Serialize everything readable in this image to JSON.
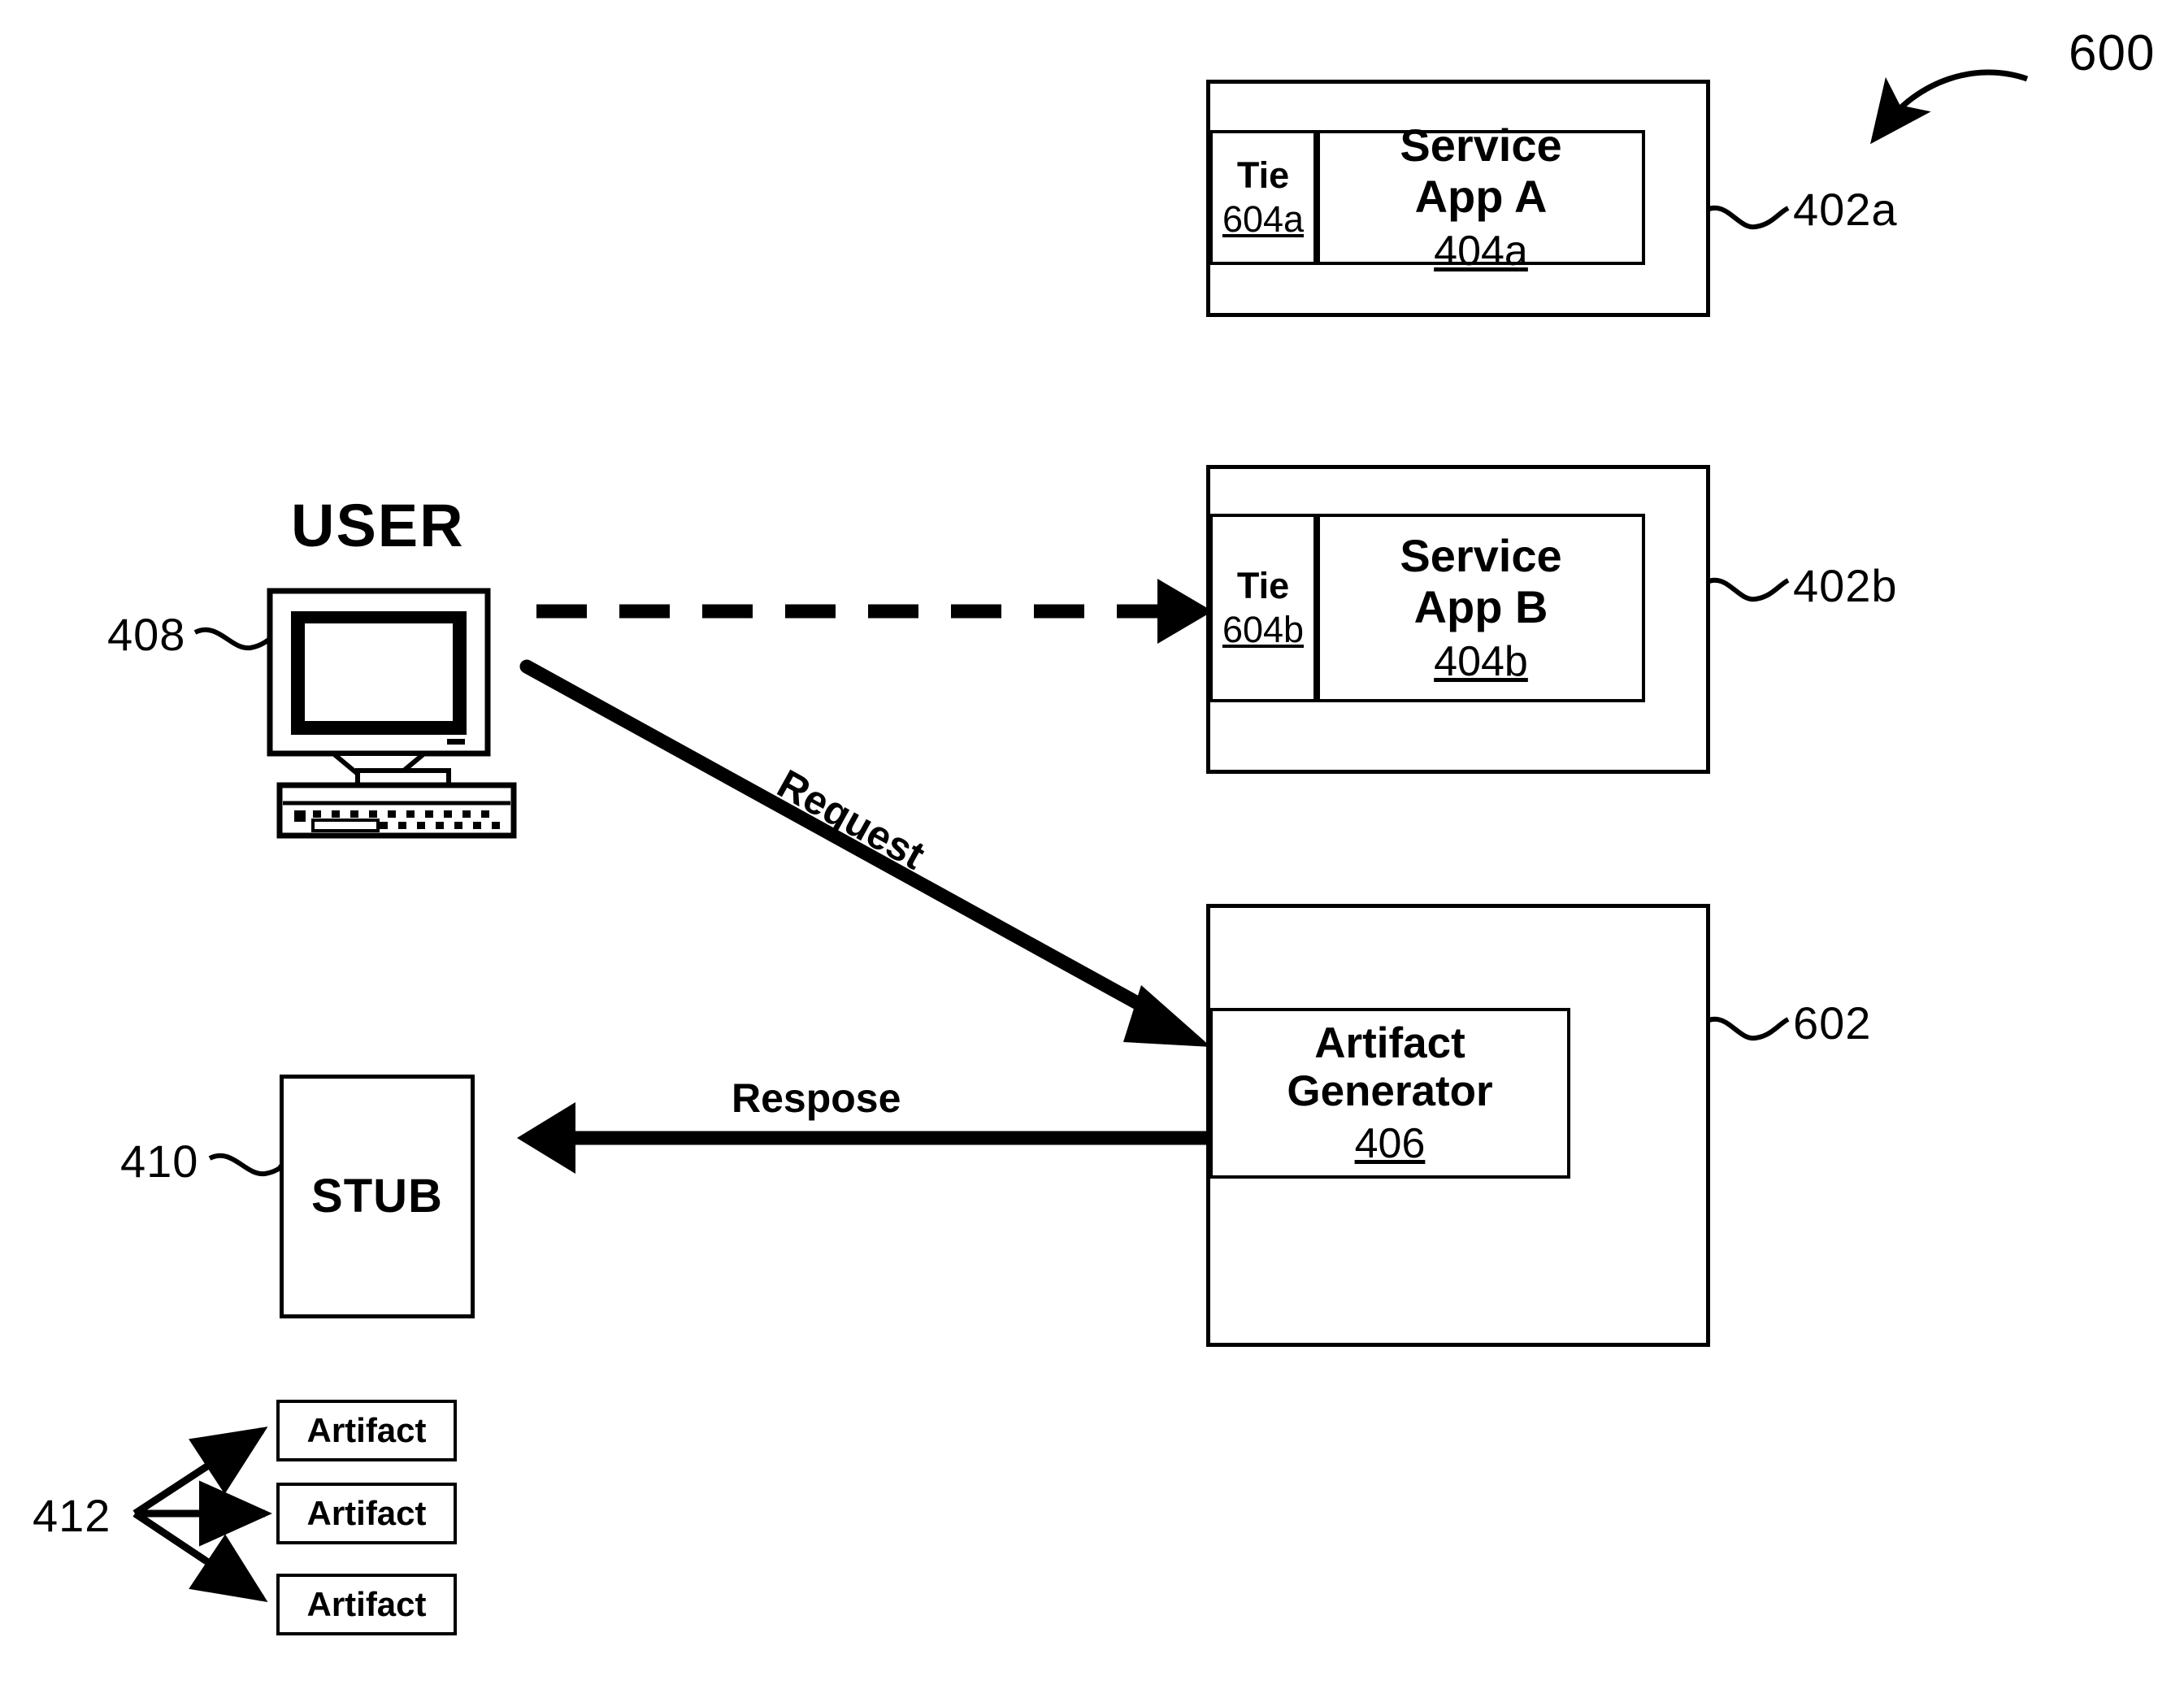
{
  "figure": {
    "number": "600",
    "user_caption": "USER"
  },
  "refs": {
    "fig": "600",
    "service_container_a": "402a",
    "service_container_b": "402b",
    "generator_container": "602",
    "user": "408",
    "stub": "410",
    "artifacts": "412"
  },
  "service_a": {
    "tie_label": "Tie",
    "tie_ref": "604a",
    "app_label_line1": "Service",
    "app_label_line2": "App A",
    "app_ref": "404a",
    "container_ref": "402a"
  },
  "service_b": {
    "tie_label": "Tie",
    "tie_ref": "604b",
    "app_label_line1": "Service",
    "app_label_line2": "App B",
    "app_ref": "404b",
    "container_ref": "402b"
  },
  "generator": {
    "label_line1": "Artifact",
    "label_line2": "Generator",
    "ref": "406",
    "container_ref": "602"
  },
  "stub": {
    "label": "STUB",
    "ref": "410"
  },
  "artifacts": {
    "ref": "412",
    "items": [
      {
        "label": "Artifact"
      },
      {
        "label": "Artifact"
      },
      {
        "label": "Artifact"
      }
    ]
  },
  "arrows": {
    "request_label": "Request",
    "response_label": "Respose",
    "dashed_user_to_service_b": "dashed-arrow"
  },
  "colors": {
    "ink": "#000000",
    "paper": "#ffffff"
  }
}
